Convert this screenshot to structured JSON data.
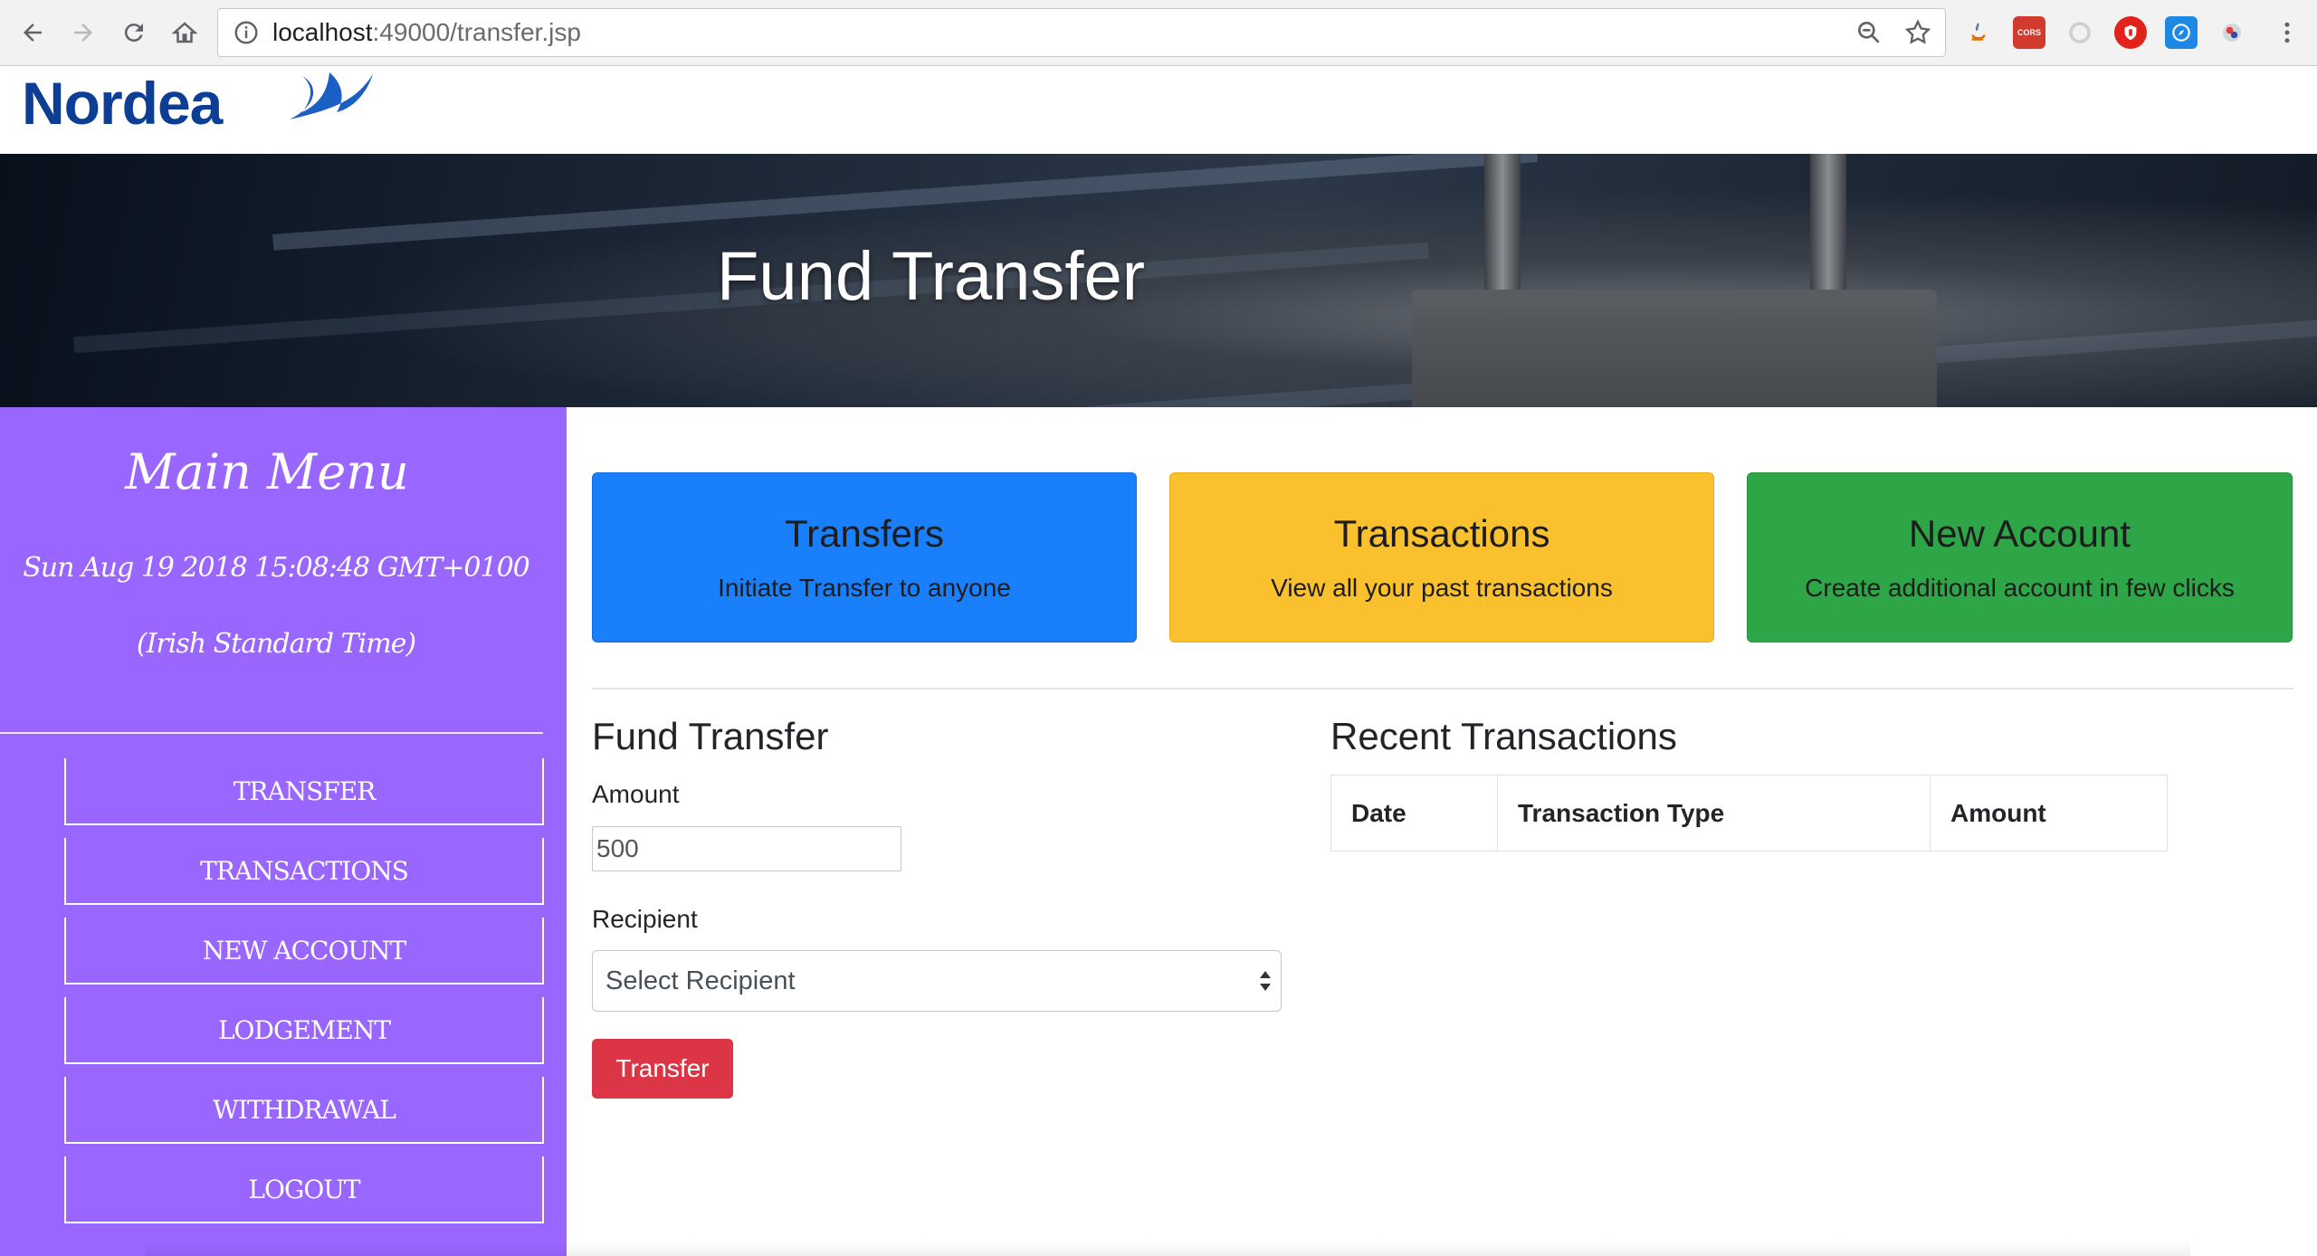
{
  "browser": {
    "url_host": "localhost",
    "url_rest": ":49000/transfer.jsp",
    "extensions": [
      "java-icon",
      "cors-icon",
      "extension-icon",
      "ublock-icon",
      "compass-icon",
      "color-picker-icon"
    ],
    "cors_label": "CORS"
  },
  "logo": {
    "text": "Nordea"
  },
  "hero": {
    "title": "Fund Transfer"
  },
  "sidebar": {
    "title": "Main Menu",
    "date": "Sun Aug 19 2018 15:08:48 GMT+0100 (Irish Standard Time)",
    "items": [
      {
        "label": "TRANSFER"
      },
      {
        "label": "TRANSACTIONS"
      },
      {
        "label": "NEW ACCOUNT"
      },
      {
        "label": "LODGEMENT"
      },
      {
        "label": "WITHDRAWAL"
      },
      {
        "label": "LOGOUT"
      }
    ]
  },
  "cards": [
    {
      "title": "Transfers",
      "subtitle": "Initiate Transfer to anyone",
      "color": "#1a7ffb"
    },
    {
      "title": "Transactions",
      "subtitle": "View all your past transactions",
      "color": "#fbc02d"
    },
    {
      "title": "New Account",
      "subtitle": "Create additional account in few clicks",
      "color": "#2ea546"
    }
  ],
  "form": {
    "title": "Fund Transfer",
    "amount_label": "Amount",
    "amount_value": "500",
    "recipient_label": "Recipient",
    "recipient_selected": "Select Recipient",
    "submit_label": "Transfer",
    "submit_color": "#dc3545"
  },
  "recent": {
    "title": "Recent Transactions",
    "columns": [
      "Date",
      "Transaction Type",
      "Amount"
    ]
  }
}
